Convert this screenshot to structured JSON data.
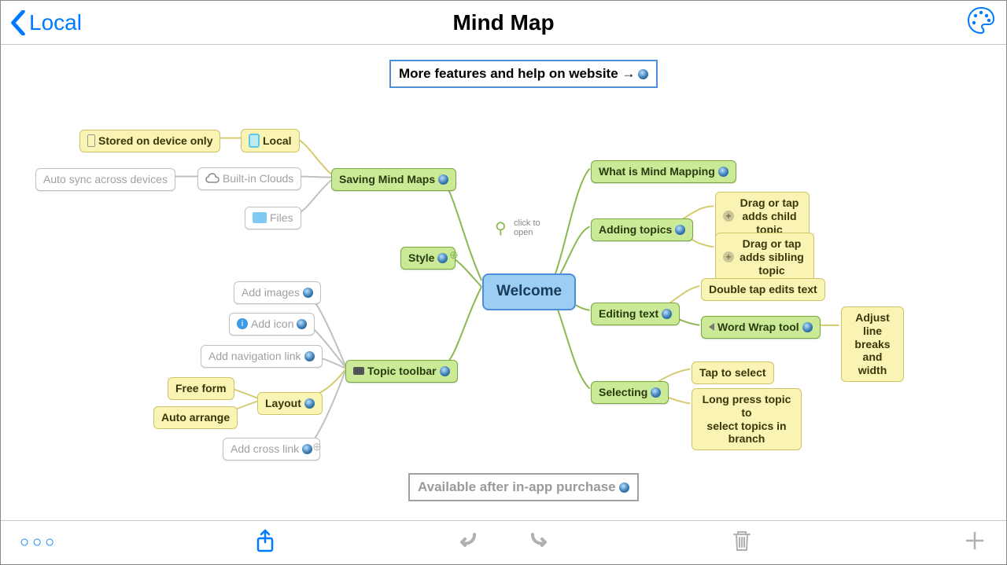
{
  "header": {
    "back_label": "Local",
    "title": "Mind Map"
  },
  "top_banner": "More features and help on website →",
  "bottom_banner": "Available after in-app purchase",
  "click_hint": "click to\nopen",
  "central": "Welcome",
  "right": {
    "what_is": "What is Mind Mapping",
    "adding": "Adding topics",
    "adding_child": "Drag or tap\nadds child topic",
    "adding_sibling": "Drag or tap\nadds sibling topic",
    "editing": "Editing text",
    "editing_double": "Double tap edits text",
    "word_wrap": "Word Wrap tool",
    "word_wrap_note": "Adjust\nline breaks\nand width",
    "selecting": "Selecting",
    "tap_select": "Tap to select",
    "long_press": "Long press topic to\nselect topics in branch"
  },
  "left": {
    "style": "Style",
    "saving": "Saving Mind Maps",
    "local": "Local",
    "stored": "Stored on device only",
    "builtin": "Built-in Clouds",
    "autosync": "Auto sync across devices",
    "files": "Files",
    "toolbar": "Topic toolbar",
    "layout": "Layout",
    "freeform": "Free form",
    "autoarrange": "Auto arrange",
    "add_images": "Add images",
    "add_icon": "Add icon",
    "add_nav": "Add navigation link",
    "add_cross": "Add cross link"
  }
}
